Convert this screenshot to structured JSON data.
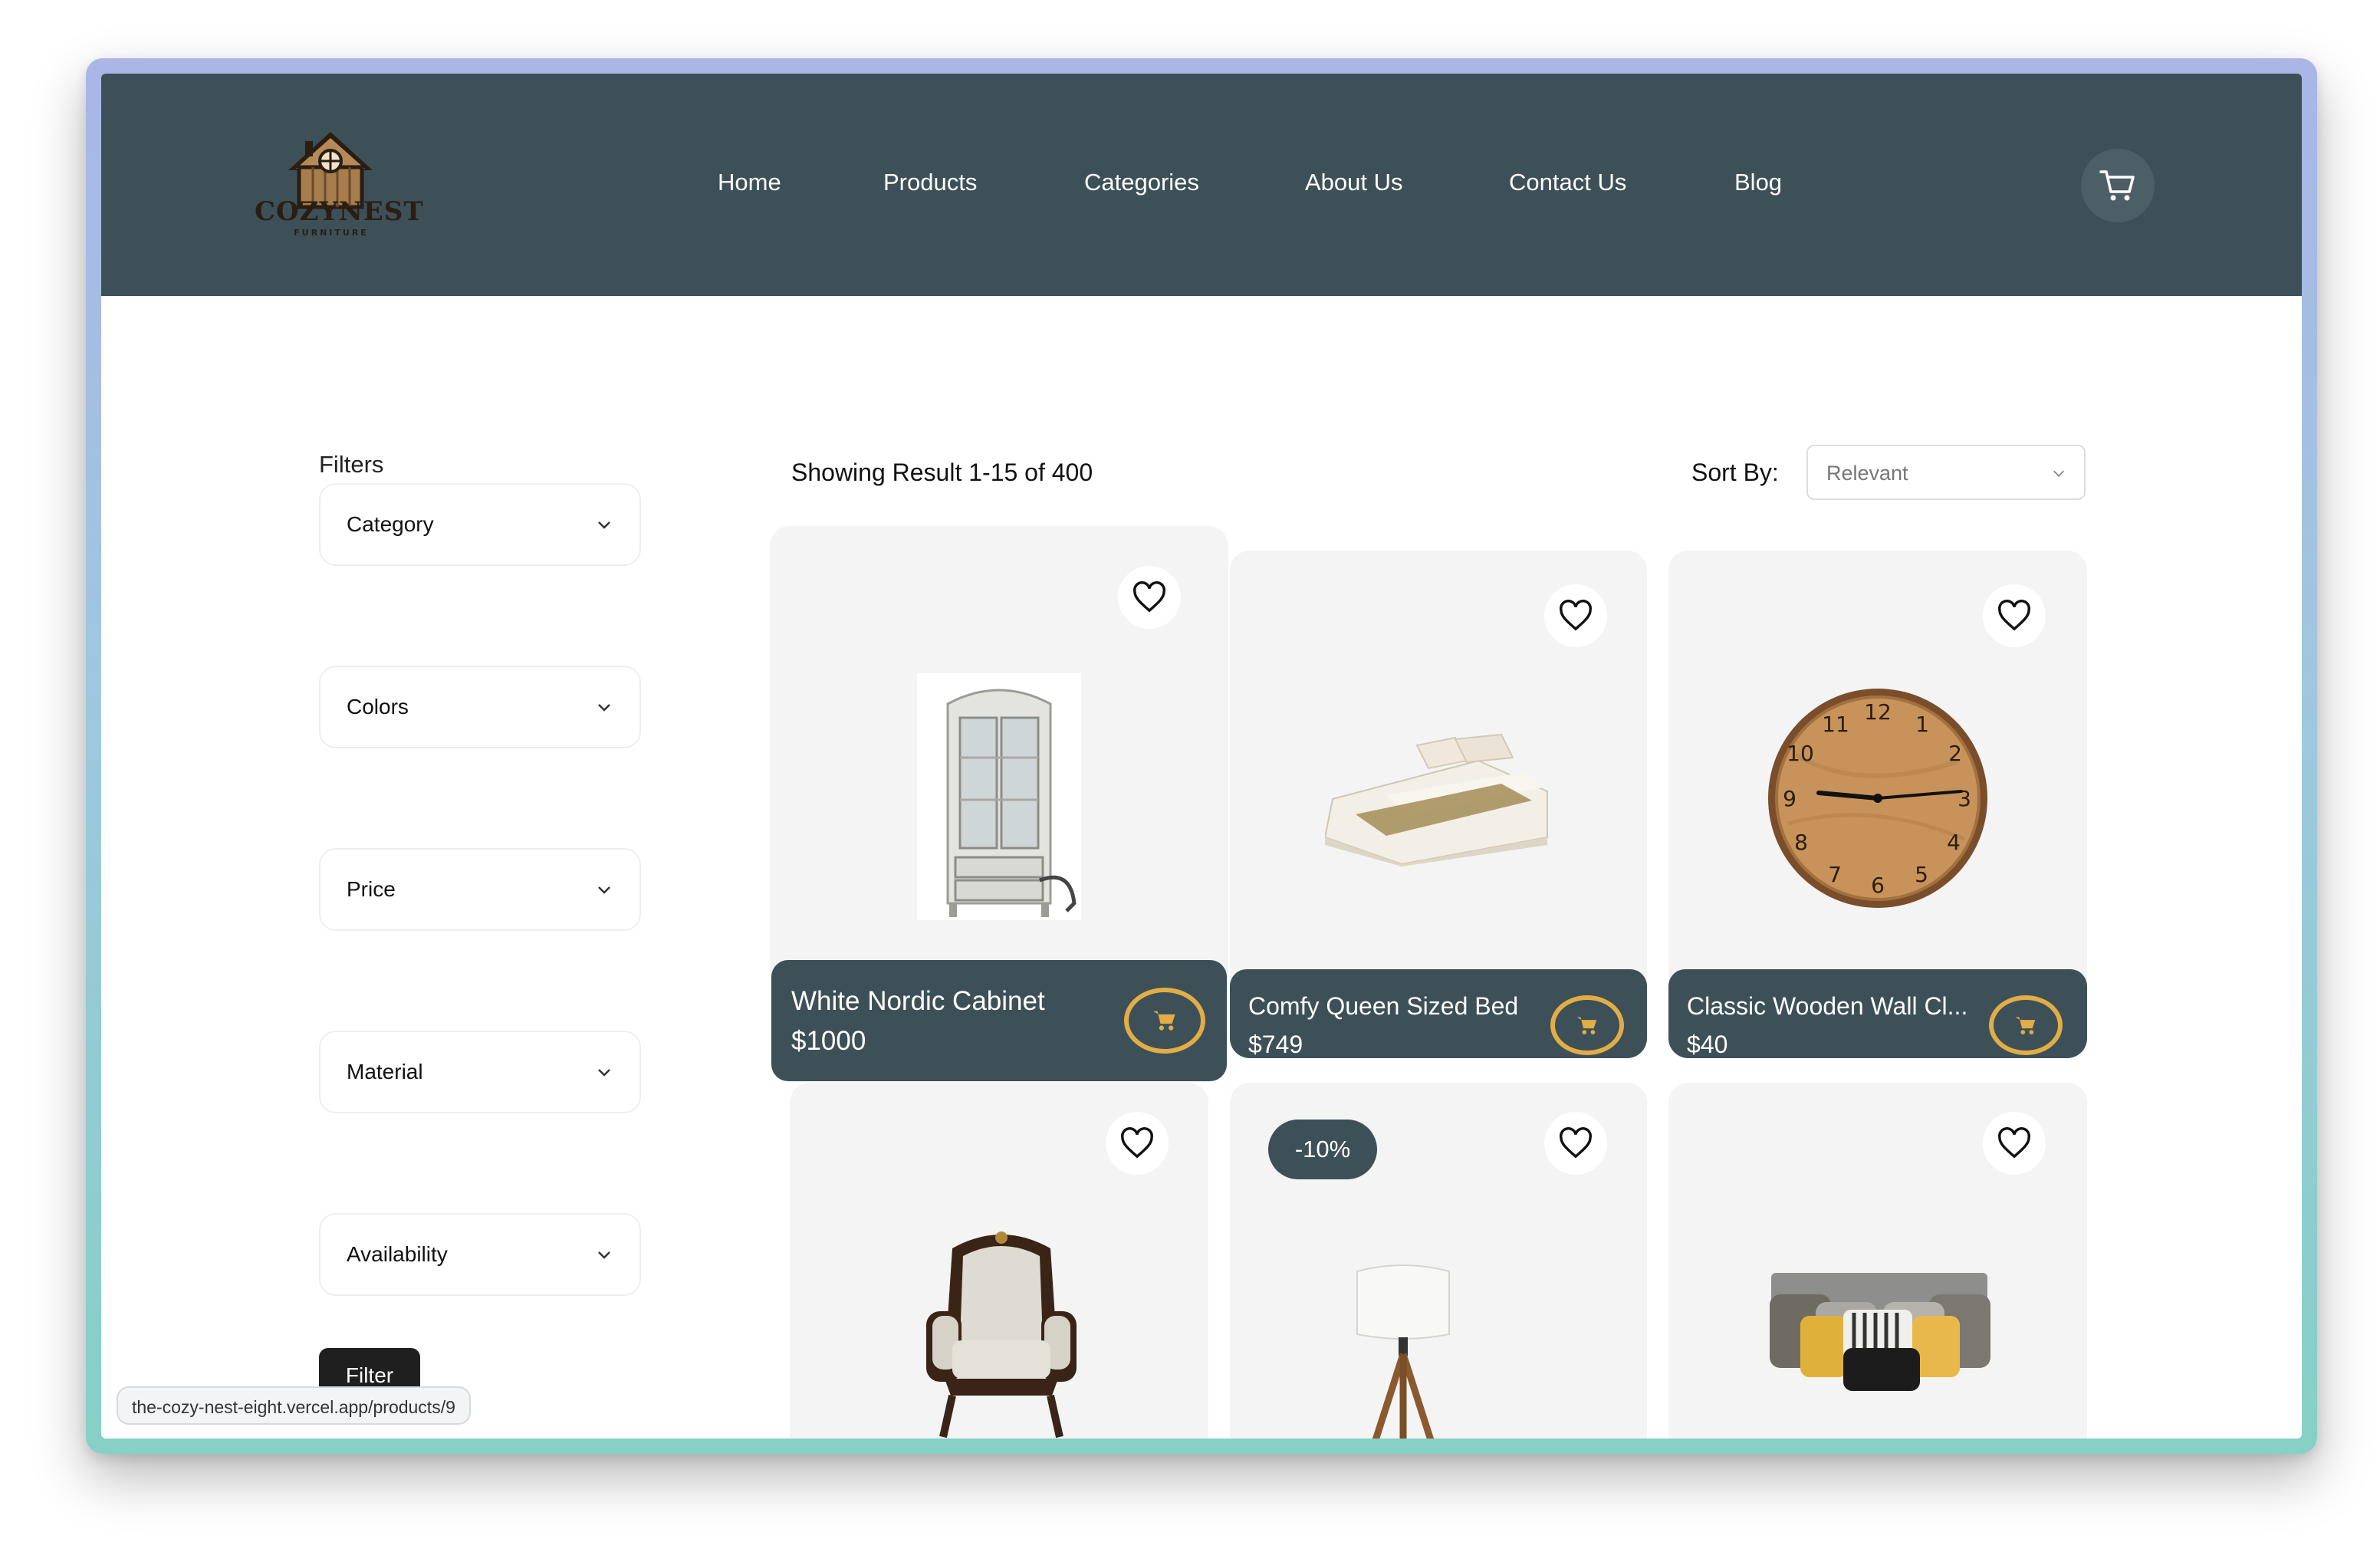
{
  "brand": {
    "name": "COZYNEST",
    "tagline": "FURNITURE"
  },
  "nav": {
    "links": [
      "Home",
      "Products",
      "Categories",
      "About Us",
      "Contact Us",
      "Blog"
    ]
  },
  "filters": {
    "title": "Filters",
    "groups": [
      "Category",
      "Colors",
      "Price",
      "Material",
      "Availability"
    ],
    "apply_label": "Filter"
  },
  "results": {
    "summary": "Showing Result 1-15 of 400"
  },
  "sort": {
    "label": "Sort By:",
    "value": "Relevant"
  },
  "products": [
    {
      "name": "White Nordic Cabinet",
      "price": "$1000"
    },
    {
      "name": "Comfy Queen Sized Bed",
      "price": "$749"
    },
    {
      "name": "Classic Wooden Wall Cl...",
      "price": "$40"
    }
  ],
  "badges": {
    "discount": "-10%"
  },
  "status_url": "the-cozy-nest-eight.vercel.app/products/9",
  "colors": {
    "navbar": "#3d5058",
    "accent": "#e2ad45",
    "card_bg": "#f4f4f4"
  },
  "icons": [
    "cart-icon",
    "heart-icon",
    "chevron-down-icon",
    "cart-add-icon"
  ]
}
